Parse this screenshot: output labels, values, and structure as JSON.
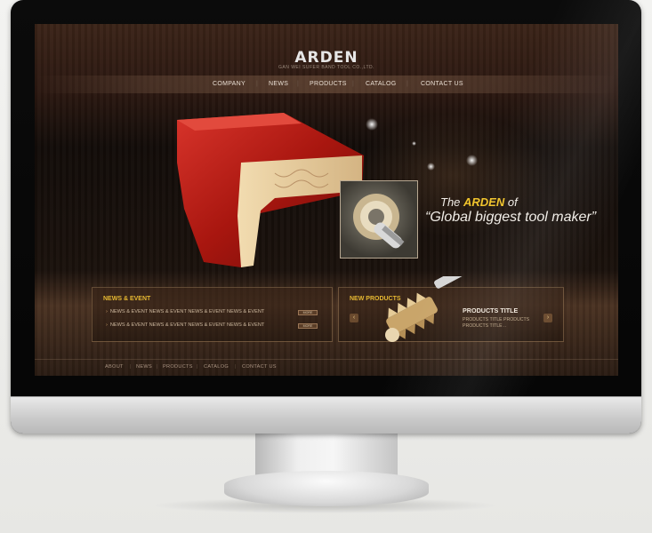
{
  "brand": {
    "logo": "ARDEN",
    "sub": "GAN WEI SUFER BAND TOOL CO.,LTD."
  },
  "nav": [
    "COMPANY",
    "NEWS",
    "PRODUCTS",
    "CATALOG",
    "CONTACT US"
  ],
  "hero": {
    "tagline_prefix": "The ",
    "tagline_brand": "ARDEN",
    "tagline_suffix": " of",
    "tagline_line2": "“Global biggest tool maker”"
  },
  "news": {
    "title": "NEWS & EVENT",
    "items": [
      {
        "text": "NEWS & EVENT NEWS & EVENT NEWS & EVENT NEWS & EVENT",
        "more": "MORE"
      },
      {
        "text": "NEWS & EVENT NEWS & EVENT NEWS & EVENT NEWS & EVENT",
        "more": "MORE"
      }
    ]
  },
  "products": {
    "title": "NEW PRODUCTS",
    "item_title": "PRODUCTS TITLE",
    "item_desc_1": "PRODUCTS TITLE PRODUCTS",
    "item_desc_2": "PRODUCTS TITLE .."
  },
  "footer": [
    "ABOUT",
    "NEWS",
    "PRODUCTS",
    "CATALOG",
    "CONTACT US"
  ],
  "colors": {
    "accent_gold": "#f1c42b",
    "frame_red": "#b01c1c",
    "wood_dark": "#2a1710"
  },
  "icons": {
    "prev": "chevron-left-icon",
    "next": "chevron-right-icon",
    "bullet": "chevron-right-icon"
  }
}
